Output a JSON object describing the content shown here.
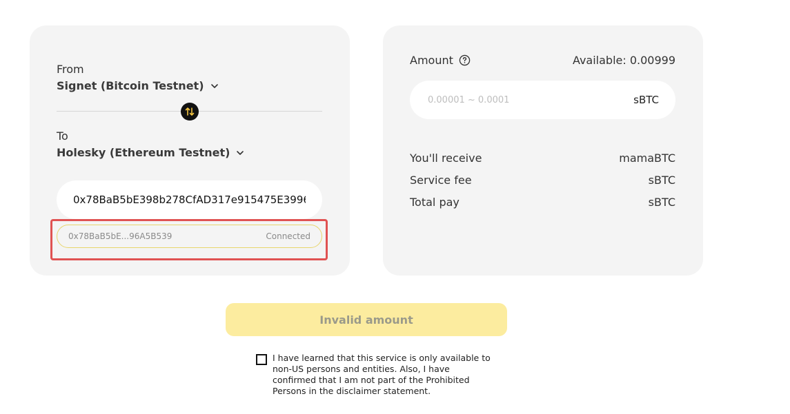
{
  "bridge": {
    "from_label": "From",
    "from_network": "Signet (Bitcoin Testnet)",
    "to_label": "To",
    "to_network": "Holesky (Ethereum Testnet)",
    "recipient_address": "0x78BaB5bE398b278CfAD317e915475E3996",
    "wallet_short": "0x78BaB5bE...96A5B539",
    "wallet_status": "Connected"
  },
  "amount": {
    "label": "Amount",
    "available": "Available: 0.00999",
    "placeholder": "0.00001 ~ 0.0001",
    "unit": "sBTC"
  },
  "summary": [
    {
      "label": "You'll receive",
      "value": "mamaBTC"
    },
    {
      "label": "Service fee",
      "value": "sBTC"
    },
    {
      "label": "Total pay",
      "value": "sBTC"
    }
  ],
  "submit_label": "Invalid amount",
  "disclaimer": "I have learned that this service is only available to non-US persons and entities. Also, I have confirmed that I am not part of the Prohibited Persons in the disclaimer statement.",
  "icons": {
    "swap": "swap-arrows-icon",
    "chevron": "chevron-down-icon",
    "help": "question-circle-icon"
  },
  "colors": {
    "card_bg": "#f4f4f4",
    "button_disabled": "#fcec9f",
    "highlight": "#e05252",
    "pill_border": "#e8d56a"
  }
}
